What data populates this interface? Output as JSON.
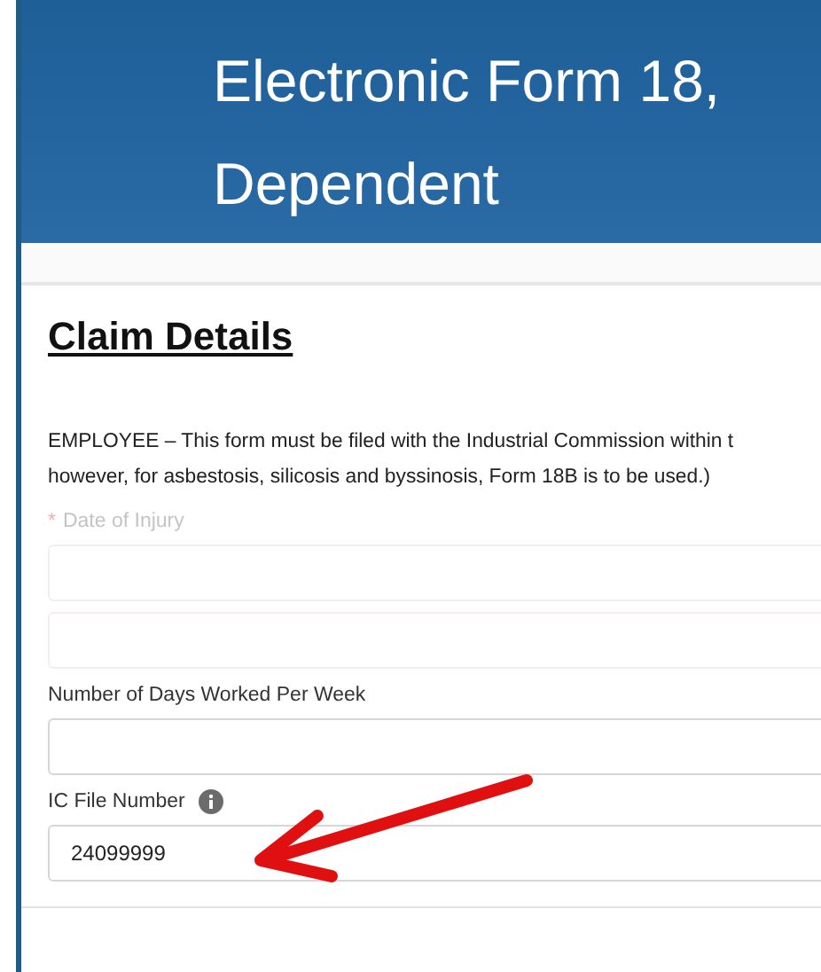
{
  "header": {
    "title_lines": [
      "Electronic Form 18,",
      "Dependent"
    ]
  },
  "section": {
    "heading": "Claim Details",
    "notice_lines": [
      "EMPLOYEE – This form must be filed with the Industrial Commission within t",
      "however, for asbestosis, silicosis and byssinosis, Form 18B is to be used.)"
    ]
  },
  "fields": [
    {
      "label": "Date of Injury",
      "required_mark": "*",
      "faded": true,
      "info": false
    },
    {
      "faded": true
    },
    {
      "label": "Number of Days Worked Per Week",
      "faded": false,
      "info": false
    },
    {
      "label": "IC File Number",
      "faded": false,
      "value": "24099999",
      "info": true
    }
  ]
}
